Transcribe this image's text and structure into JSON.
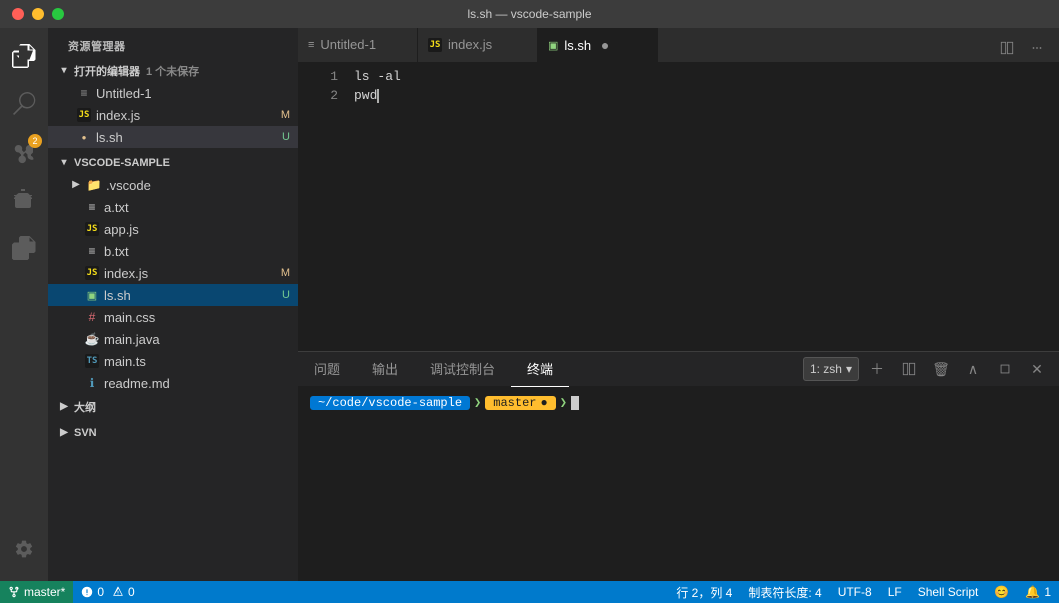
{
  "titlebar": {
    "title": "ls.sh — vscode-sample"
  },
  "activity": {
    "icons": [
      {
        "name": "files-icon",
        "symbol": "⎘",
        "badge": null,
        "active": true
      },
      {
        "name": "search-icon",
        "symbol": "🔍",
        "badge": null,
        "active": false
      },
      {
        "name": "source-control-icon",
        "symbol": "⑂",
        "badge": "2",
        "active": false
      },
      {
        "name": "debug-icon",
        "symbol": "⚙",
        "badge": null,
        "active": false
      },
      {
        "name": "extensions-icon",
        "symbol": "⊞",
        "badge": null,
        "active": false
      }
    ]
  },
  "sidebar": {
    "title": "资源管理器",
    "open_editors_label": "打开的编辑器",
    "open_editors_sub": "1 个未保存",
    "open_files": [
      {
        "name": "Untitled-1",
        "icon": "untitled",
        "badge": ""
      },
      {
        "name": "index.js",
        "icon": "js",
        "badge": "M"
      },
      {
        "name": "ls.sh",
        "icon": "sh",
        "badge": "U",
        "dot": "yellow",
        "active": true
      }
    ],
    "project_label": "VSCODE-SAMPLE",
    "files": [
      {
        "name": ".vscode",
        "icon": "folder",
        "indent": 16,
        "type": "folder"
      },
      {
        "name": "a.txt",
        "icon": "txt",
        "indent": 16
      },
      {
        "name": "app.js",
        "icon": "js",
        "indent": 16
      },
      {
        "name": "b.txt",
        "icon": "txt",
        "indent": 16
      },
      {
        "name": "index.js",
        "icon": "js",
        "indent": 16,
        "badge": "M"
      },
      {
        "name": "ls.sh",
        "icon": "sh",
        "indent": 16,
        "badge": "U",
        "active": true
      },
      {
        "name": "main.css",
        "icon": "css",
        "indent": 16
      },
      {
        "name": "main.java",
        "icon": "java",
        "indent": 16
      },
      {
        "name": "main.ts",
        "icon": "ts",
        "indent": 16
      },
      {
        "name": "readme.md",
        "icon": "md",
        "indent": 16
      }
    ],
    "outline_label": "大纲",
    "svn_label": "SVN"
  },
  "tabs": [
    {
      "name": "Untitled-1",
      "icon": "untitled",
      "active": false,
      "dot": false
    },
    {
      "name": "index.js",
      "icon": "js",
      "active": false,
      "dot": false
    },
    {
      "name": "ls.sh",
      "icon": "sh",
      "active": true,
      "dot": true
    }
  ],
  "editor": {
    "lines": [
      {
        "num": "1",
        "content": "ls -al"
      },
      {
        "num": "2",
        "content": "pwd"
      }
    ],
    "cursor_line": 2,
    "cursor_col": 4
  },
  "panel": {
    "tabs": [
      "问题",
      "输出",
      "调试控制台",
      "终端"
    ],
    "active_tab": "终端",
    "terminal_name": "1: zsh",
    "terminal_path": "~/code/vscode-sample",
    "terminal_branch": "master",
    "terminal_dot": "●"
  },
  "statusbar": {
    "branch": "master*",
    "errors": "0",
    "warnings": "0",
    "row": "行 2，列 4",
    "tabsize": "制表符长度: 4",
    "encoding": "UTF-8",
    "eol": "LF",
    "language": "Shell Script",
    "smiley": "😊",
    "bell": "🔔",
    "notif": "1"
  }
}
